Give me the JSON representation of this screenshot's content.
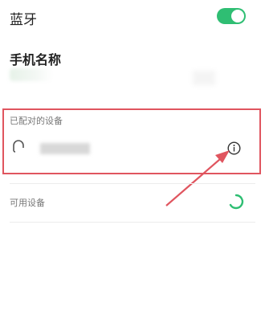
{
  "bluetooth": {
    "label": "蓝牙",
    "enabled": true
  },
  "device_name": {
    "title": "手机名称"
  },
  "paired": {
    "header": "已配对的设备"
  },
  "available": {
    "header": "可用设备"
  },
  "icons": {
    "toggle": "toggle-switch",
    "headset": "headset-icon",
    "info": "info-icon",
    "loading": "loading-spinner-icon"
  },
  "colors": {
    "accent_green": "#2fbe73",
    "highlight_red": "#e0555f"
  }
}
